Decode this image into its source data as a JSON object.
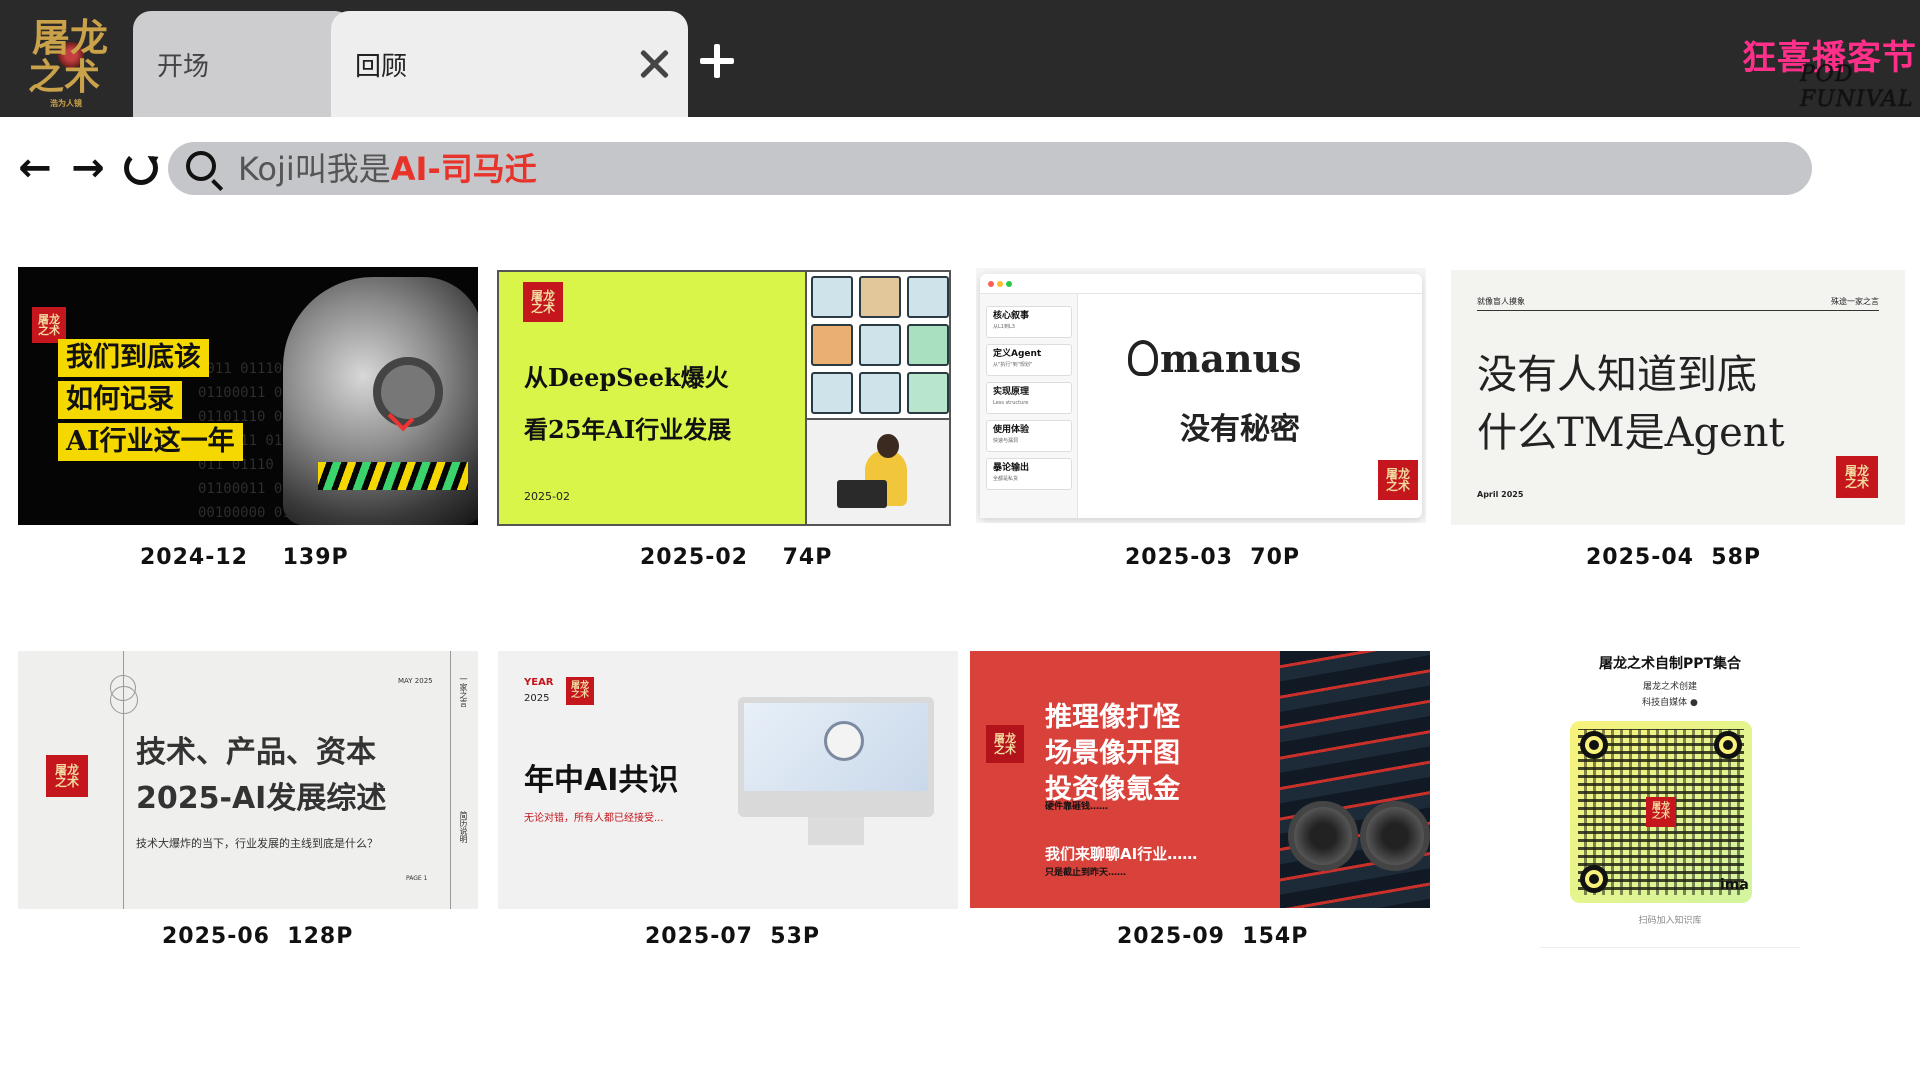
{
  "app": {
    "logo_line1": "屠龙",
    "logo_line2": "之术",
    "logo_sub": "浩为人镜",
    "brand": "狂喜播客节",
    "brand_sub": "POD FUNIVAL"
  },
  "tabs": [
    {
      "label": "开场"
    },
    {
      "label": "回顾"
    }
  ],
  "nav": {
    "back_icon": "arrow-left-icon",
    "forward_icon": "arrow-right-icon",
    "reload_icon": "reload-icon",
    "back_glyph": "←",
    "forward_glyph": "→"
  },
  "search": {
    "prefix": "Koji叫我是",
    "highlight": "AI-司马迁",
    "highlight_color": "#e8332a"
  },
  "colors": {
    "topbar": "#2a2a2a",
    "brand": "#ff2f8a",
    "seal_red": "#c4161c",
    "lime": "#d9f54a"
  },
  "cards": [
    {
      "caption": "2024-12    139P",
      "seal": "屠龙\n之术",
      "binary": [
        "0011 01110",
        "01100011 01",
        "01101110 011",
        "1100011 0110",
        "011 01110 01",
        "01100011 011",
        "00100000 01"
      ],
      "lines": [
        "我们到底该",
        "如何记录",
        "AI行业这一年"
      ]
    },
    {
      "caption": "2025-02    74P",
      "seal": "屠龙\n之术",
      "lines": [
        "从DeepSeek爆火",
        "看25年AI行业发展"
      ],
      "date": "2025-02"
    },
    {
      "caption": "2025-03  70P",
      "seal": "屠龙\n之术",
      "brand": "manus",
      "headline": "没有秘密",
      "sidebar": [
        {
          "title": "核心叙事",
          "sub": "从L1到L3"
        },
        {
          "title": "定义Agent",
          "sub": "从\"执行\"到\"规划\""
        },
        {
          "title": "实现原理",
          "sub": "Less structure"
        },
        {
          "title": "使用体验",
          "sub": "快速与漏洞"
        },
        {
          "title": "暴论输出",
          "sub": "全都是私货"
        }
      ]
    },
    {
      "caption": "2025-04  58P",
      "seal": "屠龙\n之术",
      "top_left": "就像盲人摸象",
      "top_right": "殊途一家之言",
      "lines": [
        "没有人知道到底",
        "什么TM是Agent"
      ],
      "date": "April 2025"
    },
    {
      "caption": "2025-06  128P",
      "seal": "屠龙\n之术",
      "month": "MAY 2025",
      "lines": [
        "技术、产品、资本",
        "2025-AI发展综述"
      ],
      "sub": "技术大爆炸的当下，行业发展的主线到底是什么？",
      "page": "PAGE 1",
      "side_top": "一家之言",
      "side_bottom": "简历说明"
    },
    {
      "caption": "2025-07  53P",
      "seal": "屠龙\n之术",
      "year_label": "YEAR",
      "year": "2025",
      "headline": "年中AI共识",
      "sub": "无论对错，所有人都已经接受..."
    },
    {
      "caption": "2025-09  154P",
      "seal": "屠龙\n之术",
      "lines": [
        "推理像打怪",
        "场景像开图",
        "投资像氪金"
      ],
      "small1": "硬件靠砸钱……",
      "mid": "我们来聊聊AI行业……",
      "small2": "只是截止到昨天……"
    },
    {
      "title": "屠龙之术自制PPT集合",
      "sub1": "屠龙之术创建",
      "sub2": "科技自媒体 ●",
      "seal": "屠龙\n之术",
      "tma": "ima",
      "note": "扫码加入知识库"
    }
  ]
}
